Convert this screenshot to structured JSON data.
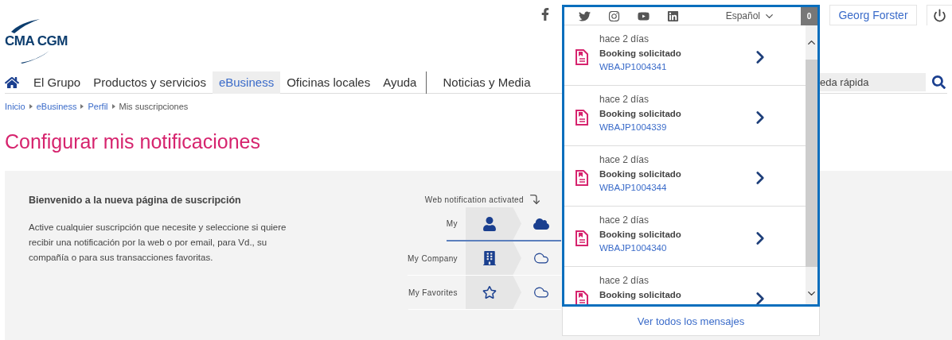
{
  "header": {
    "logo": "CMA CGM",
    "user": "Georg Forster"
  },
  "nav": {
    "items": [
      {
        "label": "El Grupo",
        "selected": false,
        "divider": false
      },
      {
        "label": "Productos y servicios",
        "selected": false,
        "divider": false
      },
      {
        "label": "eBusiness",
        "selected": true,
        "divider": false
      },
      {
        "label": "Oficinas locales",
        "selected": false,
        "divider": false
      },
      {
        "label": "Ayuda",
        "selected": false,
        "divider": false
      },
      {
        "label": "Noticias y Media",
        "selected": false,
        "divider": true
      }
    ],
    "search": {
      "placeholder": "eda rápida"
    }
  },
  "breadcrumb": [
    "Inicio",
    "eBusiness",
    "Perfil",
    "Mis suscripciones"
  ],
  "title": "Configurar mis notificaciones",
  "intro": {
    "heading": "Bienvenido a la nueva página de suscripción",
    "text": "Active cualquier suscripción que necesite y seleccione si quiere recibir una notificación por la web o por email, para Vd., su compañía o para sus transacciones favoritas."
  },
  "subscriptions": {
    "caption": "Web notification activated",
    "rows": [
      {
        "label": "My",
        "kind": "person",
        "web_active": true
      },
      {
        "label": "My Company",
        "kind": "company",
        "web_active": false
      },
      {
        "label": "My Favorites",
        "kind": "favorites",
        "web_active": false
      }
    ]
  },
  "popup": {
    "language": "Español",
    "badge": "0",
    "notifications": [
      {
        "time": "hace 2 días",
        "title": "Booking solicitado",
        "id": "WBAJP1004341"
      },
      {
        "time": "hace 2 días",
        "title": "Booking solicitado",
        "id": "WBAJP1004339"
      },
      {
        "time": "hace 2 días",
        "title": "Booking solicitado",
        "id": "WBAJP1004344"
      },
      {
        "time": "hace 2 días",
        "title": "Booking solicitado",
        "id": "WBAJP1004340"
      },
      {
        "time": "hace 2 días",
        "title": "Booking solicitado"
      }
    ],
    "footer": "Ver todos los mensajes"
  }
}
